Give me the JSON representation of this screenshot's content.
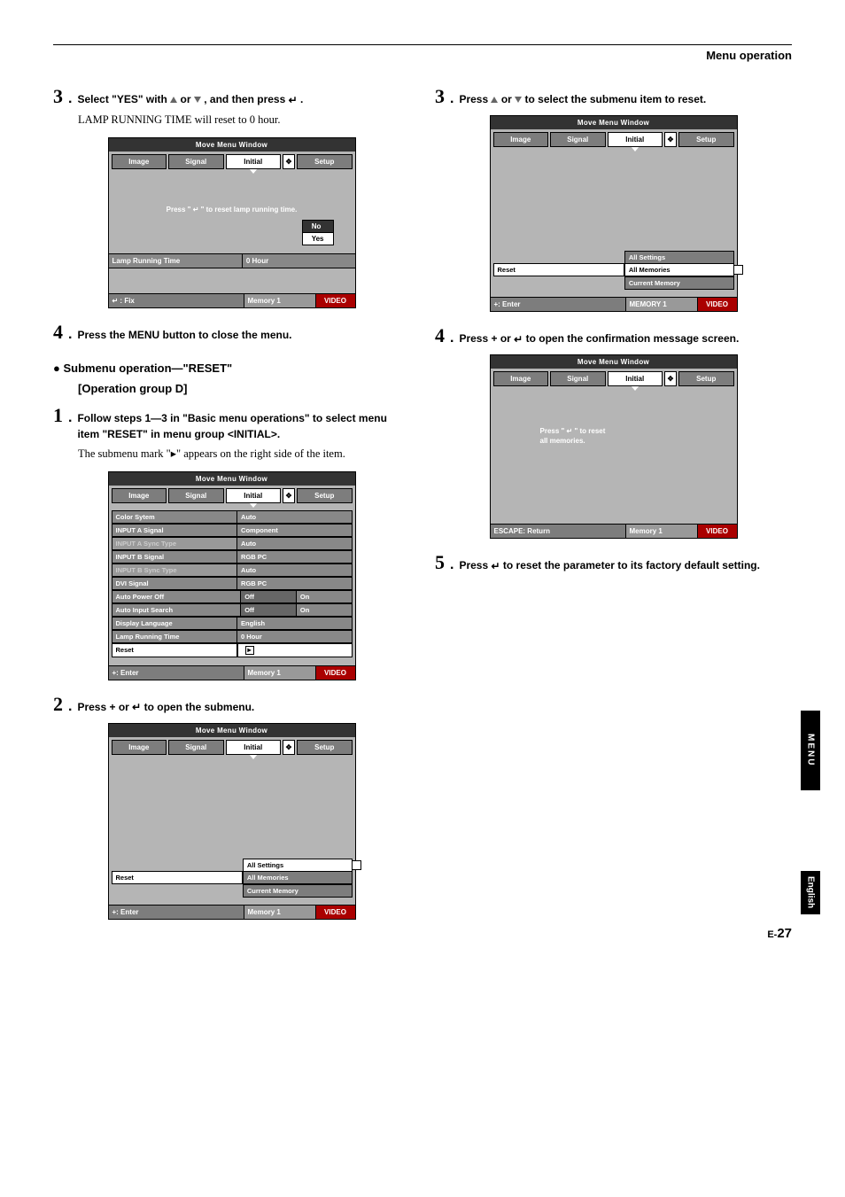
{
  "header": {
    "section": "Menu operation"
  },
  "left": {
    "s3": {
      "num": "3",
      "text_a": "Select \"YES\" with ",
      "text_b": " or ",
      "text_c": ", and then press ",
      "period": ".",
      "sub": "LAMP RUNNING TIME will reset to 0 hour."
    },
    "s4": {
      "num": "4",
      "text": "Press the MENU button to close the menu."
    },
    "bullet": "●  Submenu operation—\"RESET\"",
    "opgroup": "[Operation group D]",
    "s1": {
      "num": "1",
      "text": "Follow steps 1—3 in \"Basic menu operations\" to select menu item \"RESET\" in menu group <INITIAL>.",
      "sub_a": "The submenu mark \"",
      "sub_b": "\" appears on the right side of the item."
    },
    "s2": {
      "num": "2",
      "text_a": "Press + or ",
      "text_b": " to open the submenu."
    }
  },
  "right": {
    "s3": {
      "num": "3",
      "text_a": "Press ",
      "text_b": " or ",
      "text_c": " to select the submenu item to reset."
    },
    "s4": {
      "num": "4",
      "text_a": "Press + or ",
      "text_b": "  to open the confirmation message screen."
    },
    "s5": {
      "num": "5",
      "text_a": "Press ",
      "text_b": " to reset the parameter to its factory default setting."
    }
  },
  "menu": {
    "title": "Move Menu Window",
    "tabs": {
      "image": "Image",
      "signal": "Signal",
      "initial": "Initial",
      "setup": "Setup",
      "plus": "✥"
    },
    "footer": {
      "fix": "↵ : Fix",
      "enter": "+: Enter",
      "escape": "ESCAPE: Return",
      "memory": "Memory 1",
      "memory_caps": "MEMORY 1",
      "video": "VIDEO"
    }
  },
  "win1": {
    "msg_a": "Press \" ",
    "msg_b": " \" to reset lamp running time.",
    "no": "No",
    "yes": "Yes",
    "lamp_label": "Lamp Running Time",
    "lamp_val": "0 Hour"
  },
  "win2": {
    "rows": [
      {
        "label": "Color Sytem",
        "val": "Auto"
      },
      {
        "label": "INPUT A Signal",
        "val": "Component"
      },
      {
        "label": "INPUT A Sync Type",
        "val": "Auto",
        "dim": true
      },
      {
        "label": "INPUT B Signal",
        "val": "RGB PC"
      },
      {
        "label": "INPUT B Sync Type",
        "val": "Auto",
        "dim": true
      },
      {
        "label": "DVI Signal",
        "val": "RGB PC"
      },
      {
        "label": "Auto Power Off",
        "split": true,
        "v1": "Off",
        "v2": "On"
      },
      {
        "label": "Auto Input Search",
        "split": true,
        "v1": "Off",
        "v2": "On"
      },
      {
        "label": "Display Language",
        "val": "English"
      },
      {
        "label": "Lamp Running Time",
        "val": "0 Hour"
      }
    ],
    "reset": "Reset",
    "indicator": "▸"
  },
  "win3": {
    "reset": "Reset",
    "opts": {
      "all_settings": "All Settings",
      "all_memories": "All Memories",
      "current_memory": "Current Memory"
    }
  },
  "win4": {
    "reset": "Reset",
    "opts": {
      "all_settings": "All Settings",
      "all_memories": "All Memories",
      "current_memory": "Current Memory"
    }
  },
  "win5": {
    "msg_a": "Press \" ",
    "msg_b": " \" to reset",
    "msg_c": "all memories."
  },
  "side": {
    "menu": "MENU",
    "lang": "English"
  },
  "page": {
    "prefix": "E-",
    "num": "27"
  }
}
